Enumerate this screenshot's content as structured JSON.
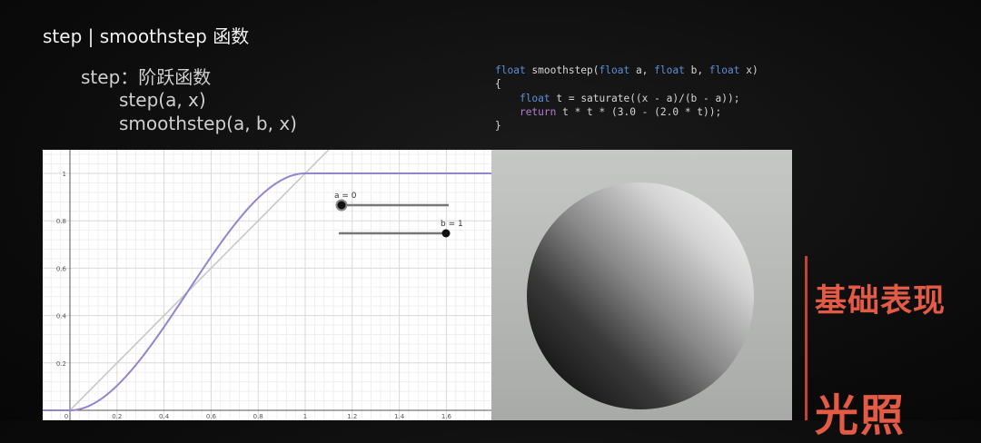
{
  "slide": {
    "title": "step | smoothstep 函数",
    "subtitle": "step：阶跃函数",
    "func_step": "step(a, x)",
    "func_smoothstep": "smoothstep(a, b, x)"
  },
  "code": {
    "lines": [
      "float smoothstep(float a, float b, float x)",
      "{",
      "    float t = saturate((x - a)/(b - a));",
      "    return t * t * (3.0 - (2.0 * t));",
      "}"
    ]
  },
  "graph": {
    "slider_a_label": "a = 0",
    "slider_b_label": "b = 1",
    "slider_a_value": 0,
    "slider_b_value": 1,
    "x_ticks": [
      "0",
      "0.2",
      "0.4",
      "0.6",
      "0.8",
      "1",
      "1.2",
      "1.4",
      "1.6"
    ],
    "y_ticks": [
      "0.2",
      "0.4",
      "0.6",
      "0.8",
      "1"
    ],
    "curve_color": "#8f86cf",
    "identity_color": "#c8c8c8"
  },
  "chart_data": {
    "type": "line",
    "xlim": [
      -0.3,
      1.85
    ],
    "ylim": [
      -0.03,
      1.07
    ],
    "grid": true,
    "series": [
      {
        "function": "smoothstep",
        "a": 0,
        "b": 1
      },
      {
        "function": "identity"
      }
    ]
  },
  "side": {
    "label1": "基础表现",
    "label2": "光照",
    "accent_color": "#e35a45"
  }
}
